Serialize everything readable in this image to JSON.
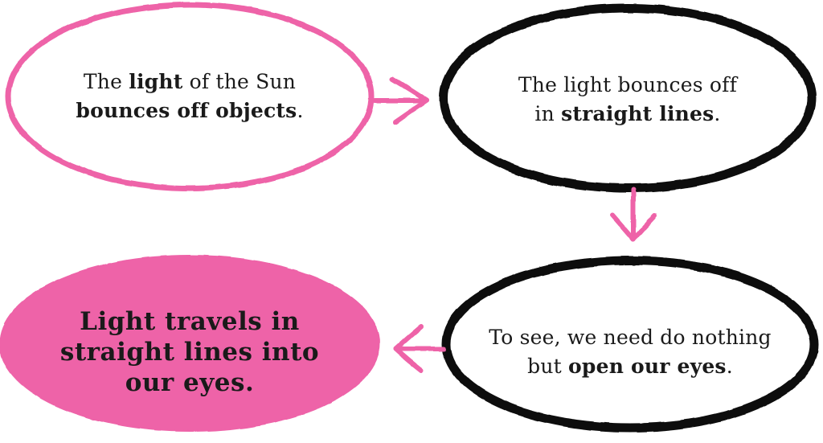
{
  "colors": {
    "pink": "#ee63a8",
    "black": "#111111",
    "text": "#1a1a1a"
  },
  "nodes": [
    {
      "id": "node1",
      "lines": [
        [
          {
            "t": "The ",
            "b": false
          },
          {
            "t": "light",
            "b": true
          },
          {
            "t": " of the Sun",
            "b": false
          }
        ],
        [
          {
            "t": "bounces off objects",
            "b": true
          },
          {
            "t": ".",
            "b": false
          }
        ]
      ]
    },
    {
      "id": "node2",
      "lines": [
        [
          {
            "t": "The light bounces off",
            "b": false
          }
        ],
        [
          {
            "t": "in ",
            "b": false
          },
          {
            "t": "straight lines",
            "b": true
          },
          {
            "t": ".",
            "b": false
          }
        ]
      ]
    },
    {
      "id": "node3",
      "lines": [
        [
          {
            "t": "To see, we need do nothing",
            "b": false
          }
        ],
        [
          {
            "t": "but ",
            "b": false
          },
          {
            "t": "open our eyes",
            "b": true
          },
          {
            "t": ".",
            "b": false
          }
        ]
      ]
    },
    {
      "id": "node4",
      "lines": [
        [
          {
            "t": "Light travels in",
            "b": true
          }
        ],
        [
          {
            "t": "straight lines into",
            "b": true
          }
        ],
        [
          {
            "t": "our eyes.",
            "b": true
          }
        ]
      ]
    }
  ]
}
